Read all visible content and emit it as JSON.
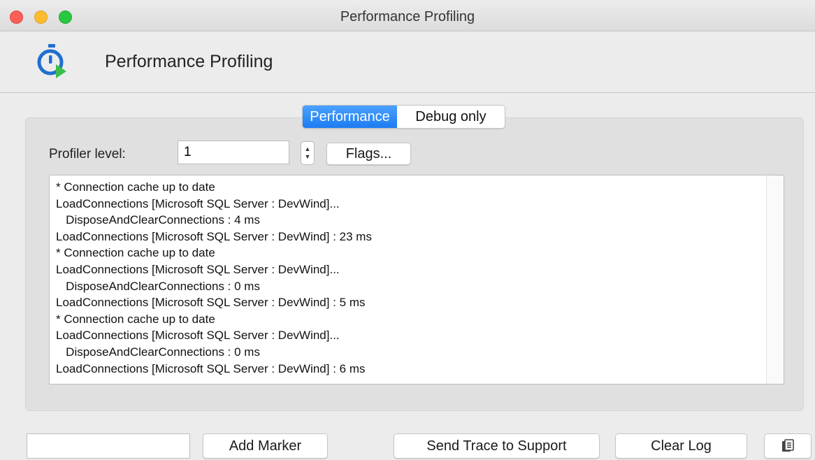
{
  "window": {
    "title": "Performance Profiling"
  },
  "header": {
    "title": "Performance Profiling",
    "icon": "stopwatch-play-icon"
  },
  "tabs": [
    {
      "label": "Performance",
      "active": true
    },
    {
      "label": "Debug only",
      "active": false
    }
  ],
  "profiler": {
    "label": "Profiler level:",
    "value": "1",
    "flags_label": "Flags..."
  },
  "log": {
    "lines": [
      "* Connection cache up to date",
      "LoadConnections [Microsoft SQL Server : DevWind]...",
      "   DisposeAndClearConnections : 4 ms",
      "LoadConnections [Microsoft SQL Server : DevWind] : 23 ms",
      "* Connection cache up to date",
      "LoadConnections [Microsoft SQL Server : DevWind]...",
      "   DisposeAndClearConnections : 0 ms",
      "LoadConnections [Microsoft SQL Server : DevWind] : 5 ms",
      "* Connection cache up to date",
      "LoadConnections [Microsoft SQL Server : DevWind]...",
      "   DisposeAndClearConnections : 0 ms",
      "LoadConnections [Microsoft SQL Server : DevWind] : 6 ms"
    ]
  },
  "footer": {
    "marker_value": "",
    "add_marker_label": "Add Marker",
    "send_trace_label": "Send Trace to Support",
    "clear_log_label": "Clear Log",
    "copy_icon": "clipboard-copy-icon"
  },
  "colors": {
    "accent": "#1d7cf2",
    "icon_blue": "#1f6fd0",
    "icon_green": "#3cbf4a"
  }
}
